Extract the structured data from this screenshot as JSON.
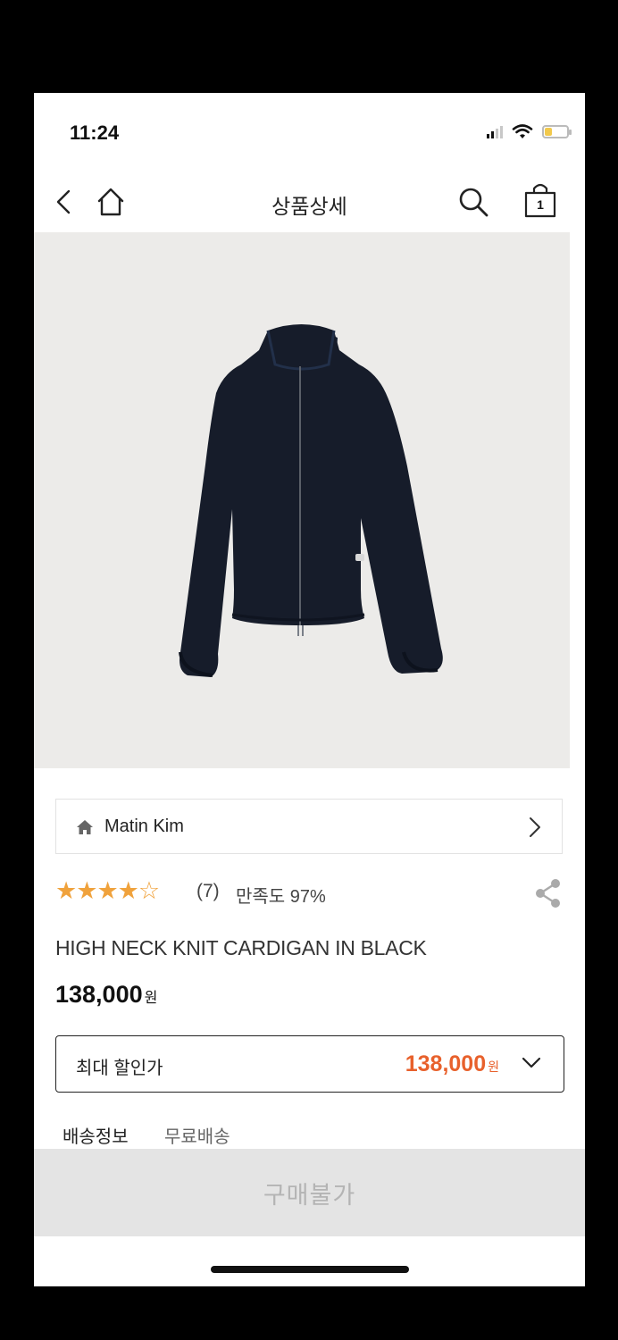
{
  "status_bar": {
    "time": "11:24"
  },
  "nav": {
    "title": "상품상세",
    "cart_count": "1"
  },
  "brand": {
    "name": "Matin Kim"
  },
  "rating": {
    "stars_filled": 4,
    "stars_total": 5,
    "review_count": "(7)",
    "satisfaction": "만족도 97%"
  },
  "product": {
    "name": "HIGH NECK KNIT CARDIGAN IN BLACK",
    "price": "138,000",
    "currency": "원"
  },
  "discount": {
    "label": "최대 할인가",
    "price": "138,000",
    "currency": "원"
  },
  "shipping": {
    "label": "배송정보",
    "value": "무료배송"
  },
  "buy_button": {
    "label": "구매불가"
  },
  "colors": {
    "accent_orange": "#e8612c",
    "star": "#f0a23c",
    "buy_disabled_bg": "#e4e4e4",
    "buy_disabled_text": "#b4b4b4"
  }
}
